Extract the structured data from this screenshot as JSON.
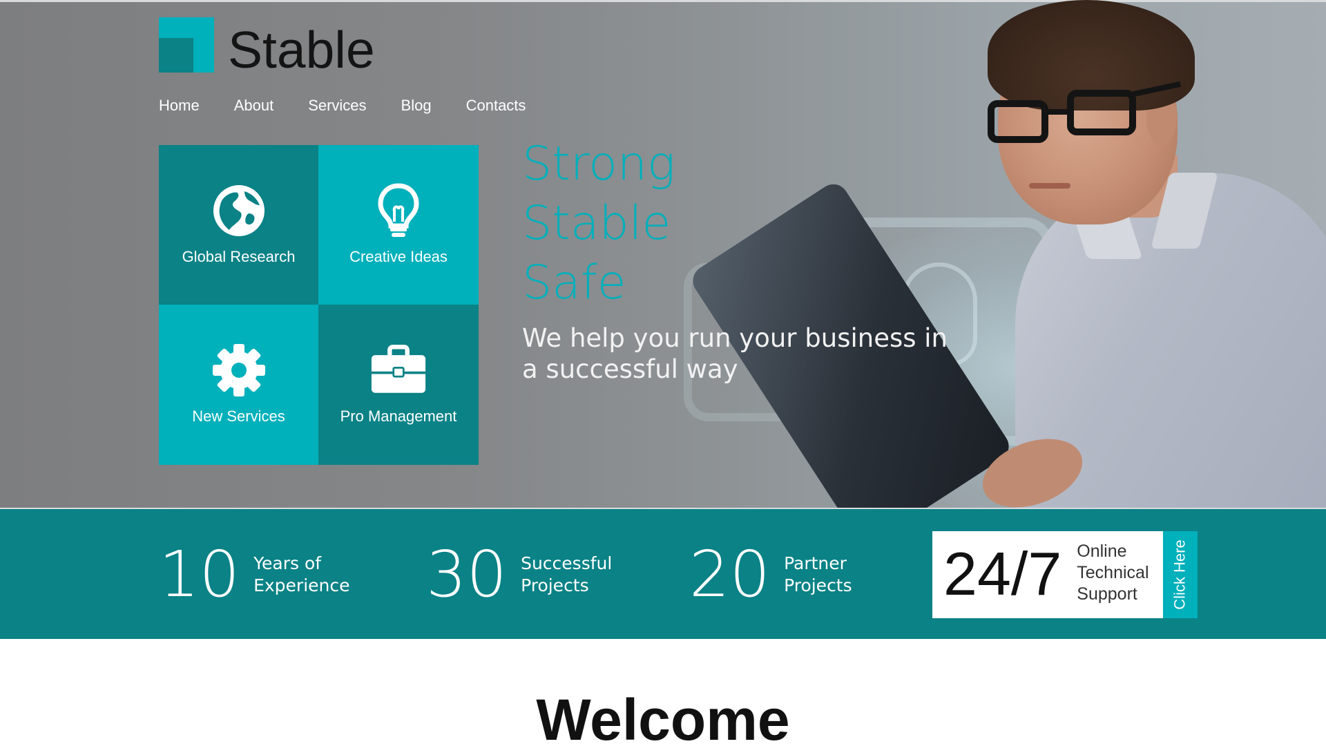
{
  "brand": {
    "name": "Stable"
  },
  "nav": {
    "items": [
      {
        "label": "Home",
        "name": "nav-home"
      },
      {
        "label": "About",
        "name": "nav-about"
      },
      {
        "label": "Services",
        "name": "nav-services"
      },
      {
        "label": "Blog",
        "name": "nav-blog"
      },
      {
        "label": "Contacts",
        "name": "nav-contacts"
      }
    ]
  },
  "tiles": [
    {
      "label": "Global Research",
      "icon": "globe-icon"
    },
    {
      "label": "Creative Ideas",
      "icon": "lightbulb-icon"
    },
    {
      "label": "New Services",
      "icon": "gear-icon"
    },
    {
      "label": "Pro Management",
      "icon": "briefcase-icon"
    }
  ],
  "hero": {
    "headline": [
      "Strong",
      "Stable",
      "Safe"
    ],
    "tagline": "We help you run your business in a successful way"
  },
  "stats": [
    {
      "number": "10",
      "label_line1": "Years of",
      "label_line2": "Experience"
    },
    {
      "number": "30",
      "label_line1": "Successful",
      "label_line2": "Projects"
    },
    {
      "number": "20",
      "label_line1": "Partner",
      "label_line2": "Projects"
    }
  ],
  "support": {
    "number": "24/7",
    "label_line1": "Online",
    "label_line2": "Technical",
    "label_line3": "Support",
    "cta": "Click Here"
  },
  "welcome": {
    "title": "Welcome"
  },
  "colors": {
    "accent": "#00b0bb",
    "accent_dark": "#0a8286",
    "text_dark": "#111111",
    "white": "#ffffff"
  }
}
